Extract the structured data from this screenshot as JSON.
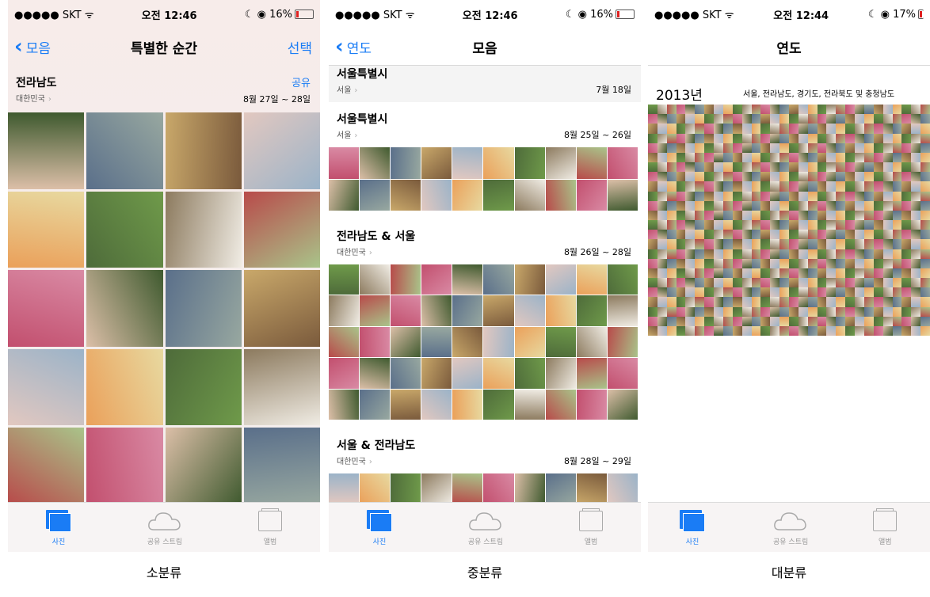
{
  "colors": {
    "accent": "#1a7cf5",
    "battery": "#e02020"
  },
  "panels": [
    {
      "status": {
        "carrier": "●●●●● SKT",
        "wifi": "ᯤ",
        "time": "오전 12:46",
        "battery": "16%"
      },
      "nav": {
        "back": "",
        "title": "특별한 순간",
        "right": "선택",
        "back_label": "모음"
      },
      "section": {
        "location": "전라남도",
        "sublocation": "대한민국",
        "share": "공유",
        "date": "8월 27일 ~ 28일"
      },
      "tabs": [
        "사진",
        "공유 스트림",
        "앨범"
      ],
      "caption": "소분류"
    },
    {
      "status": {
        "carrier": "●●●●● SKT",
        "wifi": "ᯤ",
        "time": "오전 12:46",
        "battery": "16%"
      },
      "nav": {
        "back_label": "연도",
        "title": "모음"
      },
      "sections": [
        {
          "location": "서울특별시",
          "sublocation": "서울",
          "date": "7월 18일"
        },
        {
          "location": "서울특별시",
          "sublocation": "서울",
          "date": "8월 25일 ~ 26일"
        },
        {
          "location": "전라남도 & 서울",
          "sublocation": "대한민국",
          "date": "8월 26일 ~ 28일"
        },
        {
          "location": "서울 & 전라남도",
          "sublocation": "대한민국",
          "date": "8월 28일 ~ 29일"
        }
      ],
      "tabs": [
        "사진",
        "공유 스트림",
        "앨범"
      ],
      "caption": "중분류"
    },
    {
      "status": {
        "carrier": "●●●●● SKT",
        "wifi": "ᯤ",
        "time": "오전 12:44",
        "battery": "17%"
      },
      "nav": {
        "title": "연도"
      },
      "year": "2013년",
      "year_locations": "서울, 전라남도, 경기도, 전라북도 및 충청남도",
      "tabs": [
        "사진",
        "공유 스트림",
        "앨범"
      ],
      "caption": "대분류"
    }
  ]
}
